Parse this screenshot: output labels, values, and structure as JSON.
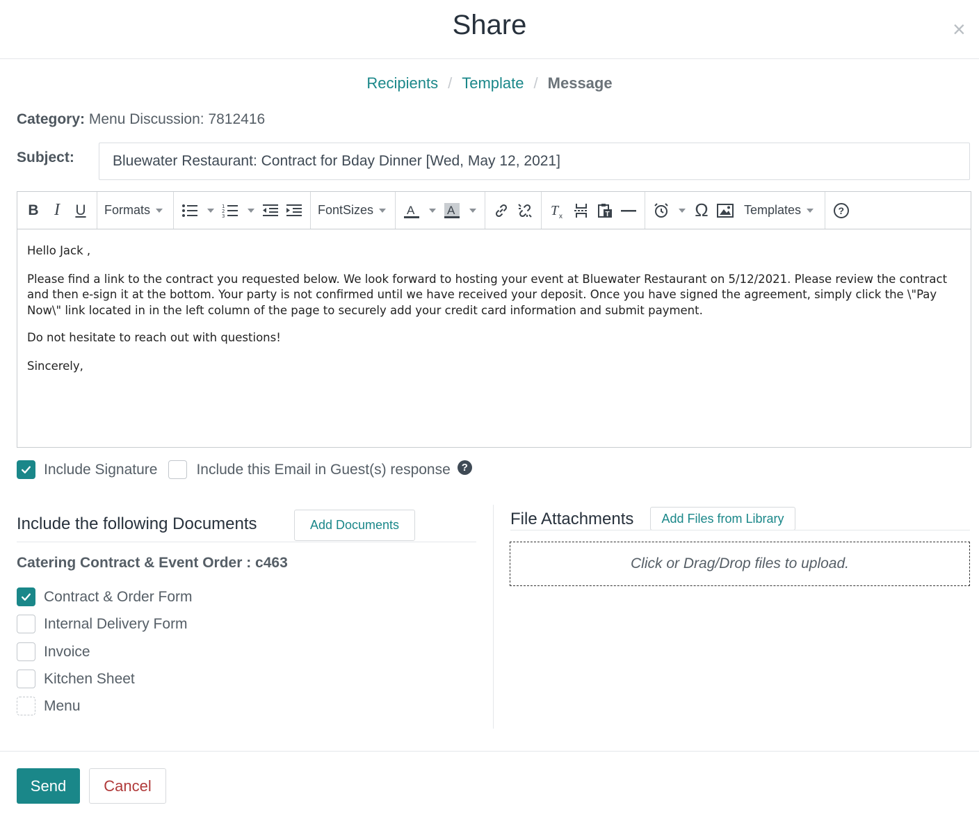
{
  "modal": {
    "title": "Share",
    "close_icon": "close-icon",
    "close_glyph": "×"
  },
  "steps": {
    "items": [
      "Recipients",
      "Template",
      "Message"
    ],
    "separator": "/",
    "active": "Message"
  },
  "category": {
    "label": "Category:",
    "value": "Menu Discussion: 7812416"
  },
  "subject": {
    "label": "Subject:",
    "value": "Bluewater Restaurant: Contract for Bday Dinner [Wed, May 12, 2021]"
  },
  "toolbar": {
    "bold": "B",
    "italic": "I",
    "underline": "U",
    "formats": "Formats",
    "fontsizes": "FontSizes",
    "templates": "Templates",
    "omega": "Ω",
    "icons": [
      "bold-icon",
      "italic-icon",
      "underline-icon",
      "bullet-list-icon",
      "numbered-list-icon",
      "outdent-icon",
      "indent-icon",
      "text-color-icon",
      "background-color-icon",
      "link-icon",
      "unlink-icon",
      "clear-format-icon",
      "page-break-icon",
      "paste-text-icon",
      "horizontal-rule-icon",
      "alarm-icon",
      "special-char-icon",
      "image-icon",
      "help-icon"
    ]
  },
  "editor": {
    "greeting": "Hello Jack ,",
    "paragraph": "Please find a link to the contract you requested below. We look forward to hosting your event at Bluewater Restaurant on 5/12/2021. Please review the contract and then e-sign it at the bottom. Your party is not confirmed until we have received your deposit. Once you have signed the agreement, simply click the \\\"Pay Now\\\" link located in in the left column of the page to securely add your credit card information and submit payment.",
    "closing_line": "Do not hesitate to reach out with questions!",
    "signoff": "Sincerely,"
  },
  "options": {
    "include_signature": {
      "label": "Include Signature",
      "checked": true
    },
    "include_email": {
      "label": "Include this Email in Guest(s) response",
      "checked": false
    },
    "help_glyph": "?"
  },
  "documents": {
    "heading": "Include the following Documents",
    "add_button": "Add Documents",
    "group_title": "Catering Contract & Event Order : c463",
    "items": [
      {
        "label": "Contract & Order Form",
        "checked": true
      },
      {
        "label": "Internal Delivery Form",
        "checked": false
      },
      {
        "label": "Invoice",
        "checked": false
      },
      {
        "label": "Kitchen Sheet",
        "checked": false
      },
      {
        "label": "Menu",
        "checked": false
      }
    ]
  },
  "attachments": {
    "heading": "File Attachments",
    "library_button": "Add Files from Library",
    "dropzone_text": "Click or Drag/Drop files to upload."
  },
  "footer": {
    "send": "Send",
    "cancel": "Cancel"
  },
  "colors": {
    "accent": "#1a8789",
    "danger": "#b03a3a",
    "text": "#3f4a55"
  }
}
